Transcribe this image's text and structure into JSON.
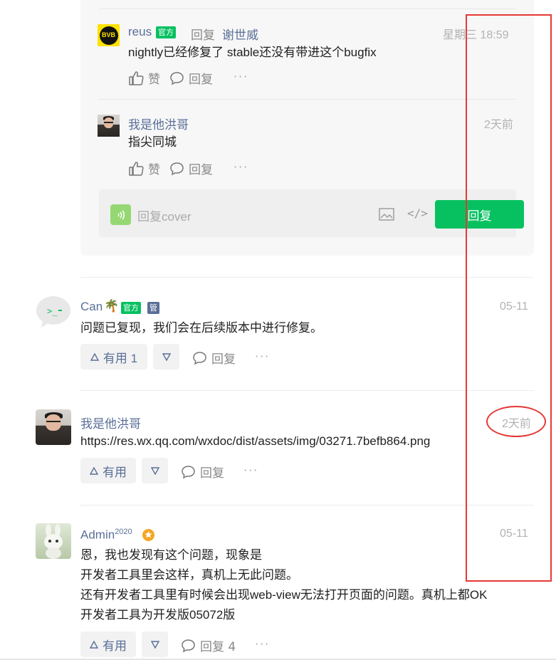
{
  "nested_replies": [
    {
      "author": "reus",
      "badge": "官方",
      "reply_label": "回复",
      "reply_to": "谢世威",
      "time": "星期三 18:59",
      "content": "nightly已经修复了 stable还没有带进这个bugfix",
      "like_label": "赞",
      "reply_action": "回复",
      "more": "···"
    },
    {
      "author": "我是他洪哥",
      "time": "2天前",
      "content": "指尖同城",
      "like_label": "赞",
      "reply_action": "回复",
      "more": "···"
    }
  ],
  "reply_box": {
    "placeholder": "回复cover",
    "code_icon": "</>",
    "submit_label": "回复"
  },
  "comments": [
    {
      "author": "Can",
      "emoji": "🌴",
      "badge_official": "官方",
      "badge_admin": "管",
      "time": "05-11",
      "content": "问题已复现，我们会在后续版本中进行修复。",
      "upvote_label": "有用 1",
      "reply_action": "回复",
      "more": "···"
    },
    {
      "author": "我是他洪哥",
      "time": "2天前",
      "content": "https://res.wx.qq.com/wxdoc/dist/assets/img/03271.7befb864.png",
      "upvote_label": "有用",
      "reply_action": "回复",
      "more": "···"
    },
    {
      "author": "Admin",
      "author_sup": "2020",
      "time": "05-11",
      "content_lines": [
        "恩，我也发现有这个问题，现象是",
        "开发者工具里会这样，真机上无此问题。",
        "还有开发者工具里有时候会出现web-view无法打开页面的问题。真机上都OK",
        "开发者工具为开发版05072版"
      ],
      "upvote_label": "有用",
      "reply_action": "回复 4",
      "more": "···"
    }
  ],
  "colors": {
    "brand_green": "#07c160",
    "link_blue": "#5a6f98",
    "annotation_red": "#e53935"
  }
}
